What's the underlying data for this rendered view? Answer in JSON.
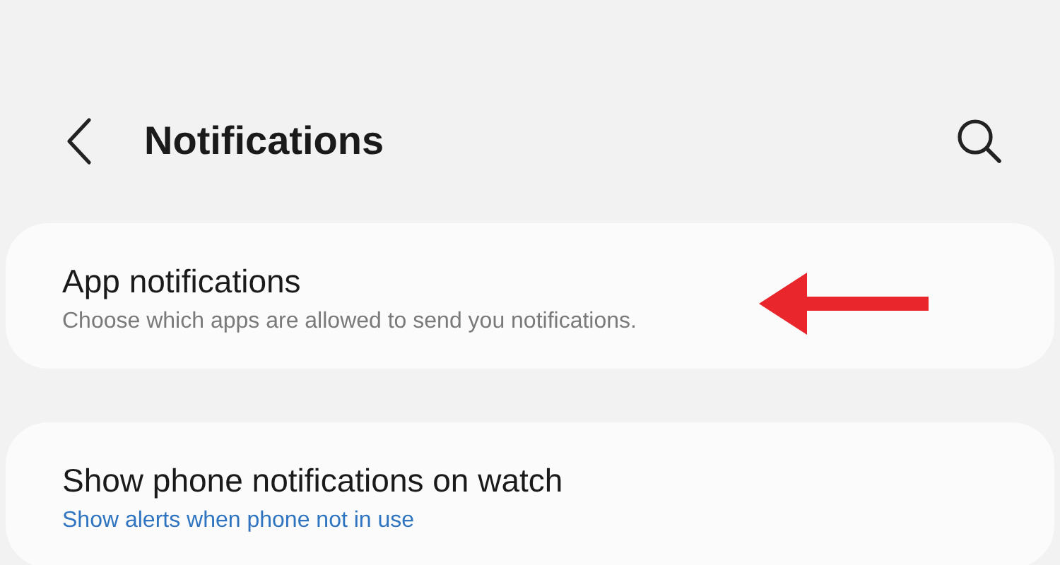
{
  "header": {
    "title": "Notifications"
  },
  "items": [
    {
      "title": "App notifications",
      "subtitle": "Choose which apps are allowed to send you notifications.",
      "kind": "plain",
      "pointer": true
    },
    {
      "title": "Show phone notifications on watch",
      "subtitle": "Show alerts when phone not in use",
      "kind": "status",
      "pointer": false
    }
  ]
}
